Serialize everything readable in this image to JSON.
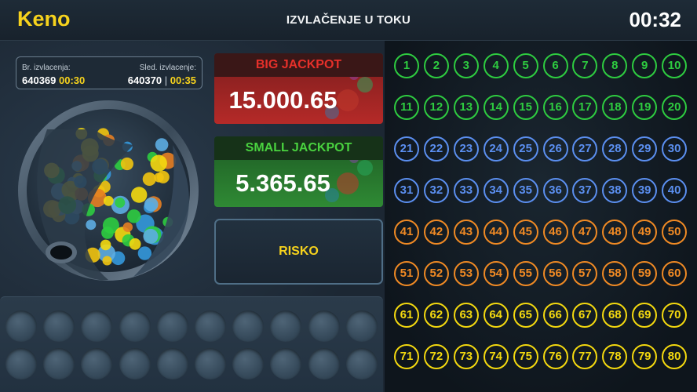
{
  "header": {
    "title": "Keno",
    "status": "IZVLAČENJE U TOKU",
    "timer": "00:32"
  },
  "draw_info": {
    "current_label": "Br. izvlacenja:",
    "current_number": "640369",
    "current_time": "00:30",
    "next_label": "Sled. izvlacenje:",
    "next_number": "640370",
    "next_separator": "|",
    "next_time": "00:35"
  },
  "jackpots": {
    "big": {
      "label": "BIG JACKPOT",
      "value": "15.000.65"
    },
    "small": {
      "label": "SMALL JACKPOT",
      "value": "5.365.65"
    }
  },
  "risko_label": "RISKO",
  "drawn_slots": {
    "rows": 2,
    "per_row": 10
  },
  "board": {
    "rows": [
      [
        "1",
        "2",
        "3",
        "4",
        "5",
        "6",
        "7",
        "8",
        "9",
        "10"
      ],
      [
        "11",
        "12",
        "13",
        "14",
        "15",
        "16",
        "17",
        "18",
        "19",
        "20"
      ],
      [
        "21",
        "22",
        "23",
        "24",
        "25",
        "26",
        "27",
        "28",
        "29",
        "30"
      ],
      [
        "31",
        "32",
        "33",
        "34",
        "35",
        "36",
        "37",
        "38",
        "39",
        "40"
      ],
      [
        "41",
        "42",
        "43",
        "44",
        "45",
        "46",
        "47",
        "48",
        "49",
        "50"
      ],
      [
        "51",
        "52",
        "53",
        "54",
        "55",
        "56",
        "57",
        "58",
        "59",
        "60"
      ],
      [
        "61",
        "62",
        "63",
        "64",
        "65",
        "66",
        "67",
        "68",
        "69",
        "70"
      ],
      [
        "71",
        "72",
        "73",
        "74",
        "75",
        "76",
        "77",
        "78",
        "79",
        "80"
      ]
    ],
    "row_colors": [
      "#2ecc40",
      "#2ecc40",
      "#5b8ff0",
      "#5b8ff0",
      "#f08a24",
      "#f08a24",
      "#f4d90f",
      "#f4d90f"
    ]
  },
  "colors": {
    "accent_yellow": "#f6d21d",
    "big_jackpot_red": "#e6302a",
    "small_jackpot_green": "#49d23f"
  }
}
